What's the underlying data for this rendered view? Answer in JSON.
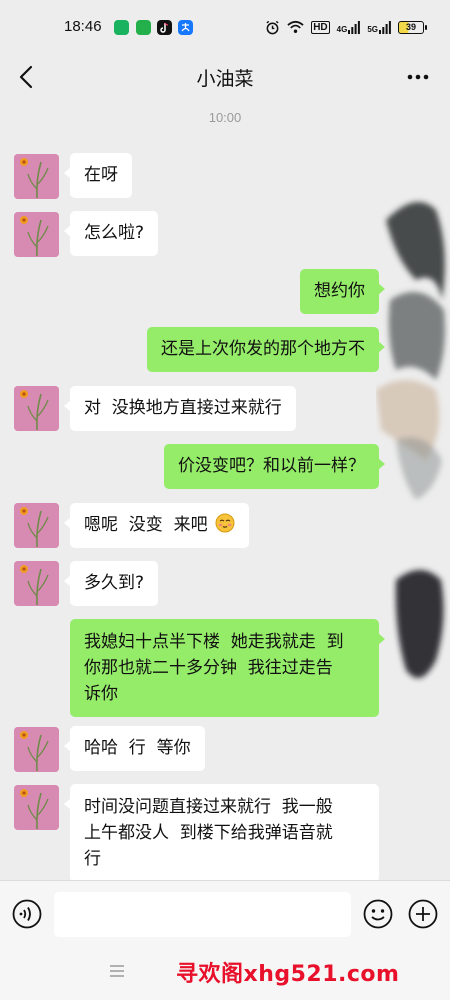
{
  "status_bar": {
    "time": "18:46",
    "network_labels": [
      "HD",
      "4G",
      "5G"
    ],
    "battery": "39",
    "icons": [
      "app-icon-1",
      "app-icon-2",
      "tiktok-icon",
      "alipay-icon",
      "alarm-icon",
      "wifi-icon",
      "signal-icon",
      "signal-icon-2",
      "battery-icon"
    ]
  },
  "header": {
    "title": "小油菜",
    "back_icon": "chevron-left-icon",
    "more_icon": "more-dots-icon"
  },
  "chat": {
    "timestamp": "10:00",
    "messages": [
      {
        "side": "in",
        "text": "在呀"
      },
      {
        "side": "in",
        "text": "怎么啦?"
      },
      {
        "side": "out",
        "text": "想约你"
      },
      {
        "side": "out",
        "text": "还是上次你发的那个地方不"
      },
      {
        "side": "in",
        "text": "对  没换地方直接过来就行"
      },
      {
        "side": "out",
        "text": "价没变吧？和以前一样？"
      },
      {
        "side": "in",
        "text": "嗯呢  没变  来吧",
        "emoji": "blushing-face-icon"
      },
      {
        "side": "in",
        "text": "多久到?"
      },
      {
        "side": "out",
        "lines": [
          "我媳妇十点半下楼  她走我就走  到",
          "你那也就二十多分钟  我往过走告",
          "诉你"
        ]
      },
      {
        "side": "in",
        "text": "哈哈  行  等你"
      },
      {
        "side": "in",
        "lines": [
          "时间没问题直接过来就行  我一般",
          "上午都没人  到楼下给我弹语音就",
          "行"
        ]
      }
    ]
  },
  "input_bar": {
    "value": "",
    "voice_icon": "voice-icon",
    "emoji_icon": "emoji-icon",
    "plus_icon": "plus-icon"
  },
  "nav_bar": {
    "menu_icon": "menu-icon"
  },
  "watermark": "寻欢阁xhg521.com",
  "colors": {
    "background": "#ededed",
    "bubble_out": "#95ec69",
    "bubble_in": "#ffffff",
    "avatar_bg": "#d88bb2",
    "watermark": "#e8102a"
  }
}
